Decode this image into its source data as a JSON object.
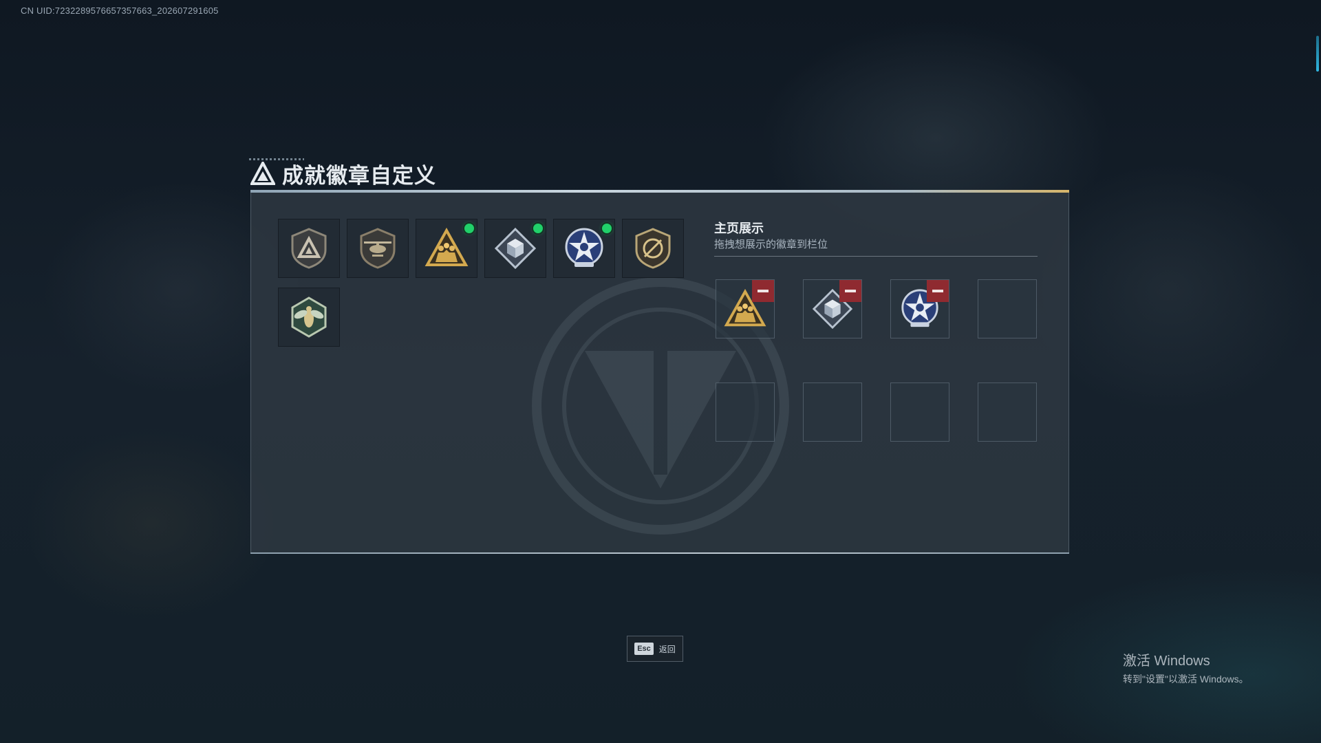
{
  "uid_text": "CN UID:7232289576657357663_202607291605",
  "header": {
    "title": "成就徽章自定义",
    "icon": "triangle-logo-icon"
  },
  "badges": [
    {
      "icon": "shield-triangle-badge-icon",
      "new": false
    },
    {
      "icon": "helicopter-shield-badge-icon",
      "new": false
    },
    {
      "icon": "gold-triangle-soldiers-badge-icon",
      "new": true
    },
    {
      "icon": "silver-diamond-cube-badge-icon",
      "new": true
    },
    {
      "icon": "blue-star-medal-badge-icon",
      "new": true
    },
    {
      "icon": "target-shield-badge-icon",
      "new": false
    },
    {
      "icon": "hornet-hexagon-badge-icon",
      "new": false
    }
  ],
  "showcase": {
    "title": "主页展示",
    "subtitle": "拖拽想展示的徽章到栏位",
    "slots": [
      {
        "icon": "gold-triangle-soldiers-badge-icon",
        "filled": true
      },
      {
        "icon": "silver-diamond-cube-badge-icon",
        "filled": true
      },
      {
        "icon": "blue-star-medal-badge-icon",
        "filled": true
      },
      {
        "filled": false
      },
      {
        "filled": false
      },
      {
        "filled": false
      },
      {
        "filled": false
      },
      {
        "filled": false
      }
    ]
  },
  "footer": {
    "esc_key": "Esc",
    "back_label": "返回"
  },
  "windows_watermark": {
    "line1": "激活 Windows",
    "line2": "转到\"设置\"以激活 Windows。"
  },
  "colors": {
    "new_dot": "#21d06a",
    "remove": "#8f2a30",
    "gold": "#c9a35a"
  }
}
